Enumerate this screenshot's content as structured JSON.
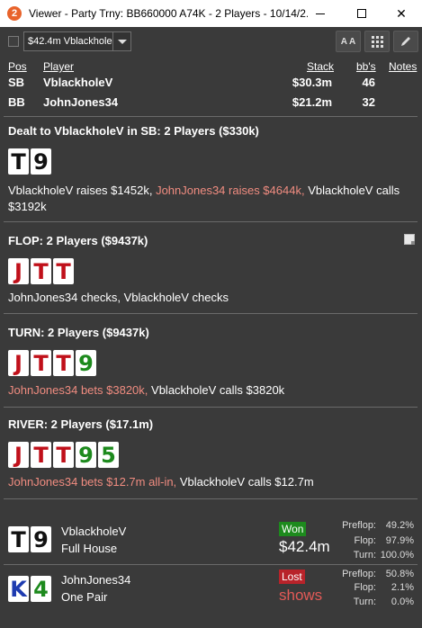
{
  "window": {
    "app_icon_label": "2",
    "title": "Viewer - Party Trny: BB660000 A74K - 2 Players - 10/14/2...",
    "min_icon": "minimize-icon",
    "max_icon": "maximize-icon",
    "close_glyph": "✕"
  },
  "toolbar": {
    "selected_hand": "$42.4m Vblackhole",
    "aa_label": "A A"
  },
  "players_table": {
    "headers": {
      "pos": "Pos",
      "player": "Player",
      "stack": "Stack",
      "bbs": "bb's",
      "notes": "Notes"
    },
    "rows": [
      {
        "pos": "SB",
        "player": "VblackholeV",
        "stack": "$30.3m",
        "bbs": "46"
      },
      {
        "pos": "BB",
        "player": "JohnJones34",
        "stack": "$21.2m",
        "bbs": "32"
      }
    ]
  },
  "preflop": {
    "title": "Dealt to VblackholeV in SB: 2 Players ($330k)",
    "cards": [
      {
        "rank": "T",
        "suit": "s"
      },
      {
        "rank": "9",
        "suit": "s"
      }
    ],
    "action_a": "VblackholeV raises $1452k,",
    "action_b": "JohnJones34 raises $4644k,",
    "action_c": "VblackholeV calls",
    "action_d": "$3192k"
  },
  "flop": {
    "title": "FLOP: 2 Players ($9437k)",
    "cards": [
      {
        "rank": "J",
        "suit": "h"
      },
      {
        "rank": "T",
        "suit": "h"
      },
      {
        "rank": "T",
        "suit": "h"
      }
    ],
    "action": "JohnJones34 checks, VblackholeV checks"
  },
  "turn": {
    "title": "TURN: 2 Players ($9437k)",
    "cards": [
      {
        "rank": "J",
        "suit": "h"
      },
      {
        "rank": "T",
        "suit": "h"
      },
      {
        "rank": "T",
        "suit": "h"
      },
      {
        "rank": "9",
        "suit": "c"
      }
    ],
    "action_a": "JohnJones34 bets $3820k,",
    "action_b": "VblackholeV calls $3820k"
  },
  "river": {
    "title": "RIVER: 2 Players ($17.1m)",
    "cards": [
      {
        "rank": "J",
        "suit": "h"
      },
      {
        "rank": "T",
        "suit": "h"
      },
      {
        "rank": "T",
        "suit": "h"
      },
      {
        "rank": "9",
        "suit": "c"
      },
      {
        "rank": "5",
        "suit": "c"
      }
    ],
    "action_a": "JohnJones34 bets $12.7m all-in,",
    "action_b": "VblackholeV calls $12.7m"
  },
  "results": [
    {
      "cards": [
        {
          "rank": "T",
          "suit": "s"
        },
        {
          "rank": "9",
          "suit": "s"
        }
      ],
      "name": "VblackholeV",
      "hand": "Full House",
      "badge": "Won",
      "amount": "$42.4m",
      "equity": {
        "preflop_label": "Preflop:",
        "preflop": "49.2%",
        "flop_label": "Flop:",
        "flop": "97.9%",
        "turn_label": "Turn:",
        "turn": "100.0%"
      }
    },
    {
      "cards": [
        {
          "rank": "K",
          "suit": "d"
        },
        {
          "rank": "4",
          "suit": "c"
        }
      ],
      "name": "JohnJones34",
      "hand": "One Pair",
      "badge": "Lost",
      "amount": "shows",
      "equity": {
        "preflop_label": "Preflop:",
        "preflop": "50.8%",
        "flop_label": "Flop:",
        "flop": "2.1%",
        "turn_label": "Turn:",
        "turn": "0.0%"
      }
    }
  ]
}
